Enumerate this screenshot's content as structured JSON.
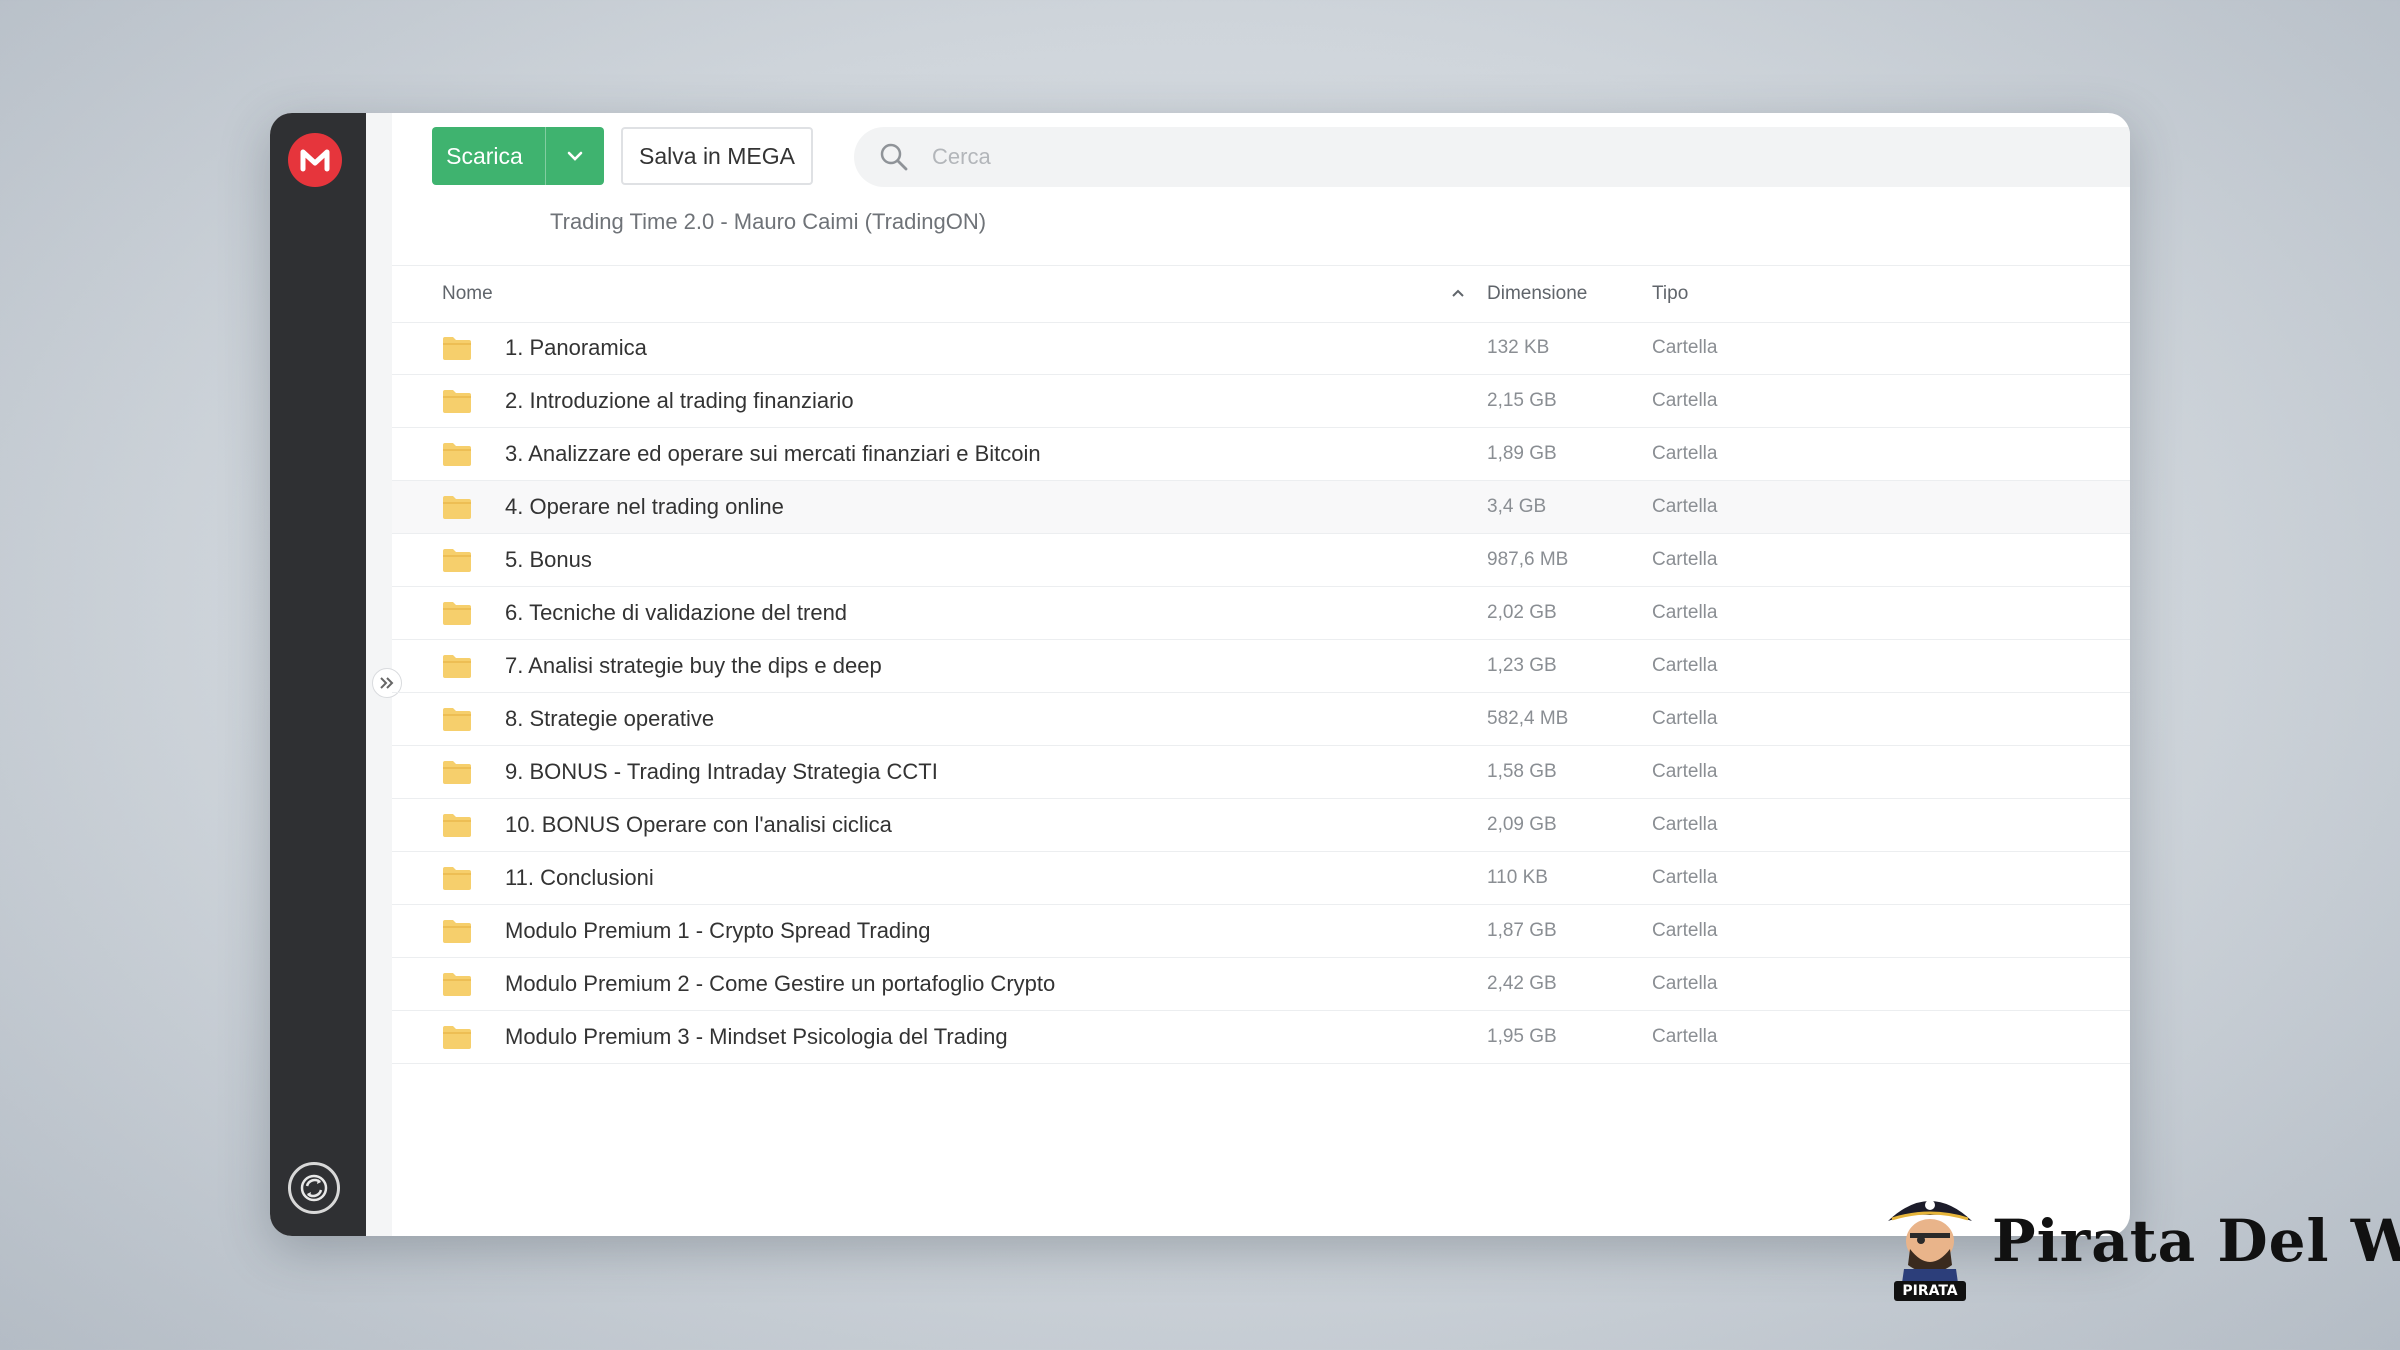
{
  "toolbar": {
    "download_label": "Scarica",
    "save_label": "Salva in MEGA",
    "search_placeholder": "Cerca"
  },
  "breadcrumb": "Trading Time 2.0 - Mauro Caimi (TradingON)",
  "table": {
    "columns": {
      "name": "Nome",
      "size": "Dimensione",
      "type": "Tipo"
    },
    "rows": [
      {
        "name": "1. Panoramica",
        "size": "132 KB",
        "type": "Cartella"
      },
      {
        "name": "2. Introduzione al trading finanziario",
        "size": "2,15 GB",
        "type": "Cartella"
      },
      {
        "name": "3. Analizzare ed operare sui mercati finanziari e Bitcoin",
        "size": "1,89 GB",
        "type": "Cartella"
      },
      {
        "name": "4. Operare nel trading online",
        "size": "3,4 GB",
        "type": "Cartella"
      },
      {
        "name": "5. Bonus",
        "size": "987,6 MB",
        "type": "Cartella"
      },
      {
        "name": "6. Tecniche di validazione del trend",
        "size": "2,02 GB",
        "type": "Cartella"
      },
      {
        "name": "7. Analisi strategie buy the dips e deep",
        "size": "1,23 GB",
        "type": "Cartella"
      },
      {
        "name": "8. Strategie operative",
        "size": "582,4 MB",
        "type": "Cartella"
      },
      {
        "name": "9. BONUS - Trading Intraday Strategia CCTI",
        "size": "1,58 GB",
        "type": "Cartella"
      },
      {
        "name": "10. BONUS Operare con l'analisi ciclica",
        "size": "2,09 GB",
        "type": "Cartella"
      },
      {
        "name": "11. Conclusioni",
        "size": "110 KB",
        "type": "Cartella"
      },
      {
        "name": "Modulo Premium 1 - Crypto Spread Trading",
        "size": "1,87 GB",
        "type": "Cartella"
      },
      {
        "name": "Modulo Premium 2 - Come Gestire un portafoglio Crypto",
        "size": "2,42 GB",
        "type": "Cartella"
      },
      {
        "name": "Modulo Premium 3 - Mindset Psicologia del Trading",
        "size": "1,95 GB",
        "type": "Cartella"
      }
    ]
  },
  "brand": {
    "name": "Pirata Del Web",
    "mascot_label": "PIRATA"
  },
  "colors": {
    "accent_green": "#3fb36f",
    "mega_red": "#e6353c",
    "sidebar": "#2f3033",
    "folder": "#f6cf6c"
  },
  "icons": {
    "logo": "mega-logo-icon",
    "search": "search-icon",
    "dropdown": "chevron-down-icon",
    "folder": "folder-icon",
    "expand": "double-chevron-right-icon",
    "sync": "sync-icon",
    "sort": "chevron-up-icon"
  }
}
